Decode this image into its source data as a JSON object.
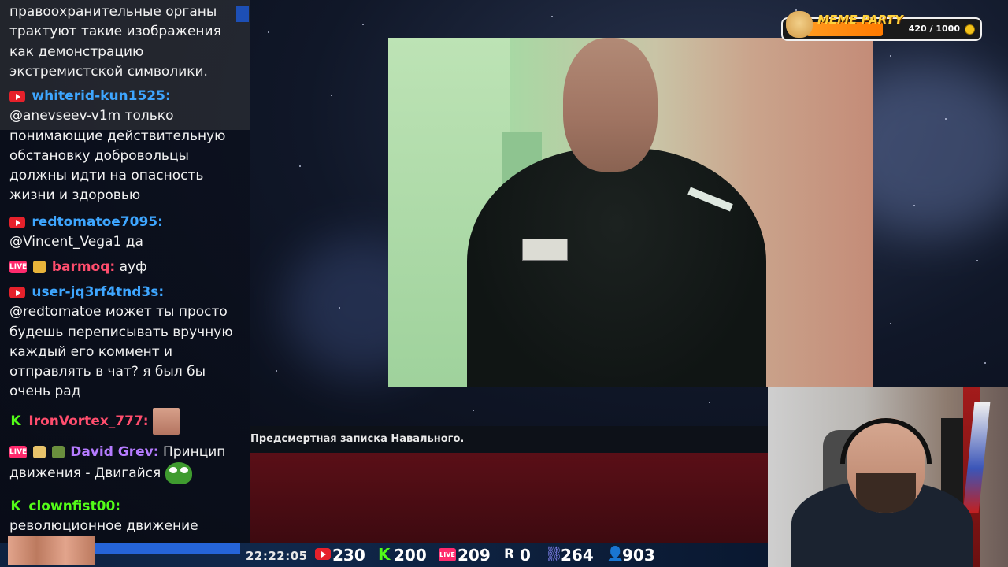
{
  "chat": {
    "messages": [
      {
        "platform": "none",
        "user": "",
        "text": "правоохранительные органы трактуют такие изображения как демонстрацию экстремистской символики."
      },
      {
        "platform": "youtube",
        "user": "whiterid-kun1525:",
        "user_color": "#3ea6ff",
        "text": "@anevseev-v1m только понимающие действительную обстановку добровольцы должны идти на опасность жизни и здоровью"
      },
      {
        "platform": "youtube",
        "user": "redtomatoe7095:",
        "user_color": "#3ea6ff",
        "text": "@Vincent_Vega1 да"
      },
      {
        "platform": "live",
        "user": "barmoq:",
        "user_color": "#ff4d6d",
        "text": "ауф"
      },
      {
        "platform": "youtube",
        "user": "user-jq3rf4tnd3s:",
        "user_color": "#3ea6ff",
        "text": "@redtomatoe может ты просто будешь переписывать вручную каждый его коммент и отправлять в чат? я был бы очень рад"
      },
      {
        "platform": "kick",
        "user": "IronVortex_777:",
        "user_color": "#ff4d6d",
        "text": ""
      },
      {
        "platform": "live",
        "user": "David Grev:",
        "user_color": "#b57bff",
        "text": "Принцип движения - Двигайся"
      },
      {
        "platform": "kick",
        "user": "clownfist00:",
        "user_color": "#53fc18",
        "text": "революционное движение"
      }
    ]
  },
  "caption": "Предсмертная записка Навального.",
  "meme_party": {
    "title": "MEME PARTY",
    "count": "420 / 1000",
    "progress": 0.42
  },
  "status": {
    "time": "22:22:05",
    "youtube": "230",
    "kick": "200",
    "live": "209",
    "r": "0",
    "chain": "264",
    "viewers": "903"
  },
  "icons": {
    "live_label": "LIVE",
    "kick_label": "K",
    "r_label": "R"
  }
}
